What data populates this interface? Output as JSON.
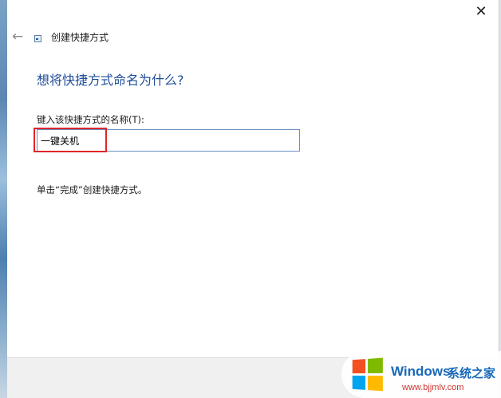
{
  "window": {
    "close_glyph": "✕",
    "back_glyph": "←",
    "wizard_title": "创建快捷方式"
  },
  "content": {
    "question": "想将快捷方式命名为什么?",
    "field_label": "键入该快捷方式的名称(T):",
    "name_value": "一键关机",
    "hint": "单击“完成”创建快捷方式。"
  },
  "annotation": {
    "highlight_color": "#e0262a"
  },
  "watermark": {
    "brand": "Windows",
    "site": "系统之家",
    "url": "www.bjjmlv.com"
  }
}
